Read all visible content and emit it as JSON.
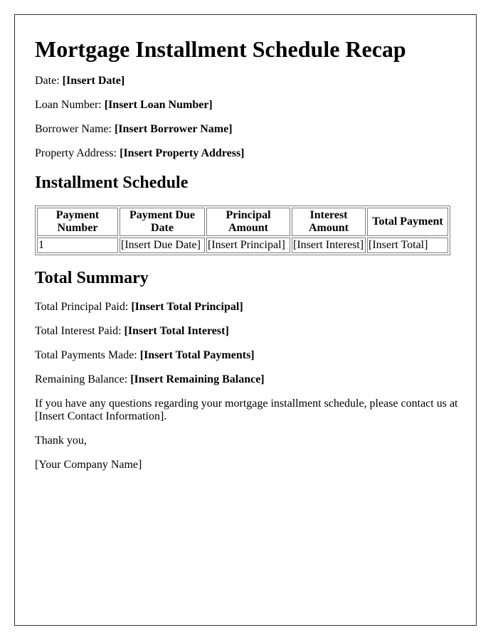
{
  "document": {
    "title": "Mortgage Installment Schedule Recap",
    "fields": [
      {
        "label": "Date:",
        "value": "[Insert Date]"
      },
      {
        "label": "Loan Number:",
        "value": "[Insert Loan Number]"
      },
      {
        "label": "Borrower Name:",
        "value": "[Insert Borrower Name]"
      },
      {
        "label": "Property Address:",
        "value": "[Insert Property Address]"
      }
    ],
    "schedule": {
      "heading": "Installment Schedule",
      "columns": [
        "Payment Number",
        "Payment Due Date",
        "Principal Amount",
        "Interest Amount",
        "Total Payment"
      ],
      "rows": [
        [
          "1",
          "[Insert Due Date]",
          "[Insert Principal]",
          "[Insert Interest]",
          "[Insert Total]"
        ]
      ]
    },
    "summary": {
      "heading": "Total Summary",
      "fields": [
        {
          "label": "Total Principal Paid:",
          "value": "[Insert Total Principal]"
        },
        {
          "label": "Total Interest Paid:",
          "value": "[Insert Total Interest]"
        },
        {
          "label": "Total Payments Made:",
          "value": "[Insert Total Payments]"
        },
        {
          "label": "Remaining Balance:",
          "value": "[Insert Remaining Balance]"
        }
      ]
    },
    "contact_text": "If you have any questions regarding your mortgage installment schedule, please contact us at [Insert Contact Information].",
    "closing": "Thank you,",
    "signature": "[Your Company Name]"
  }
}
